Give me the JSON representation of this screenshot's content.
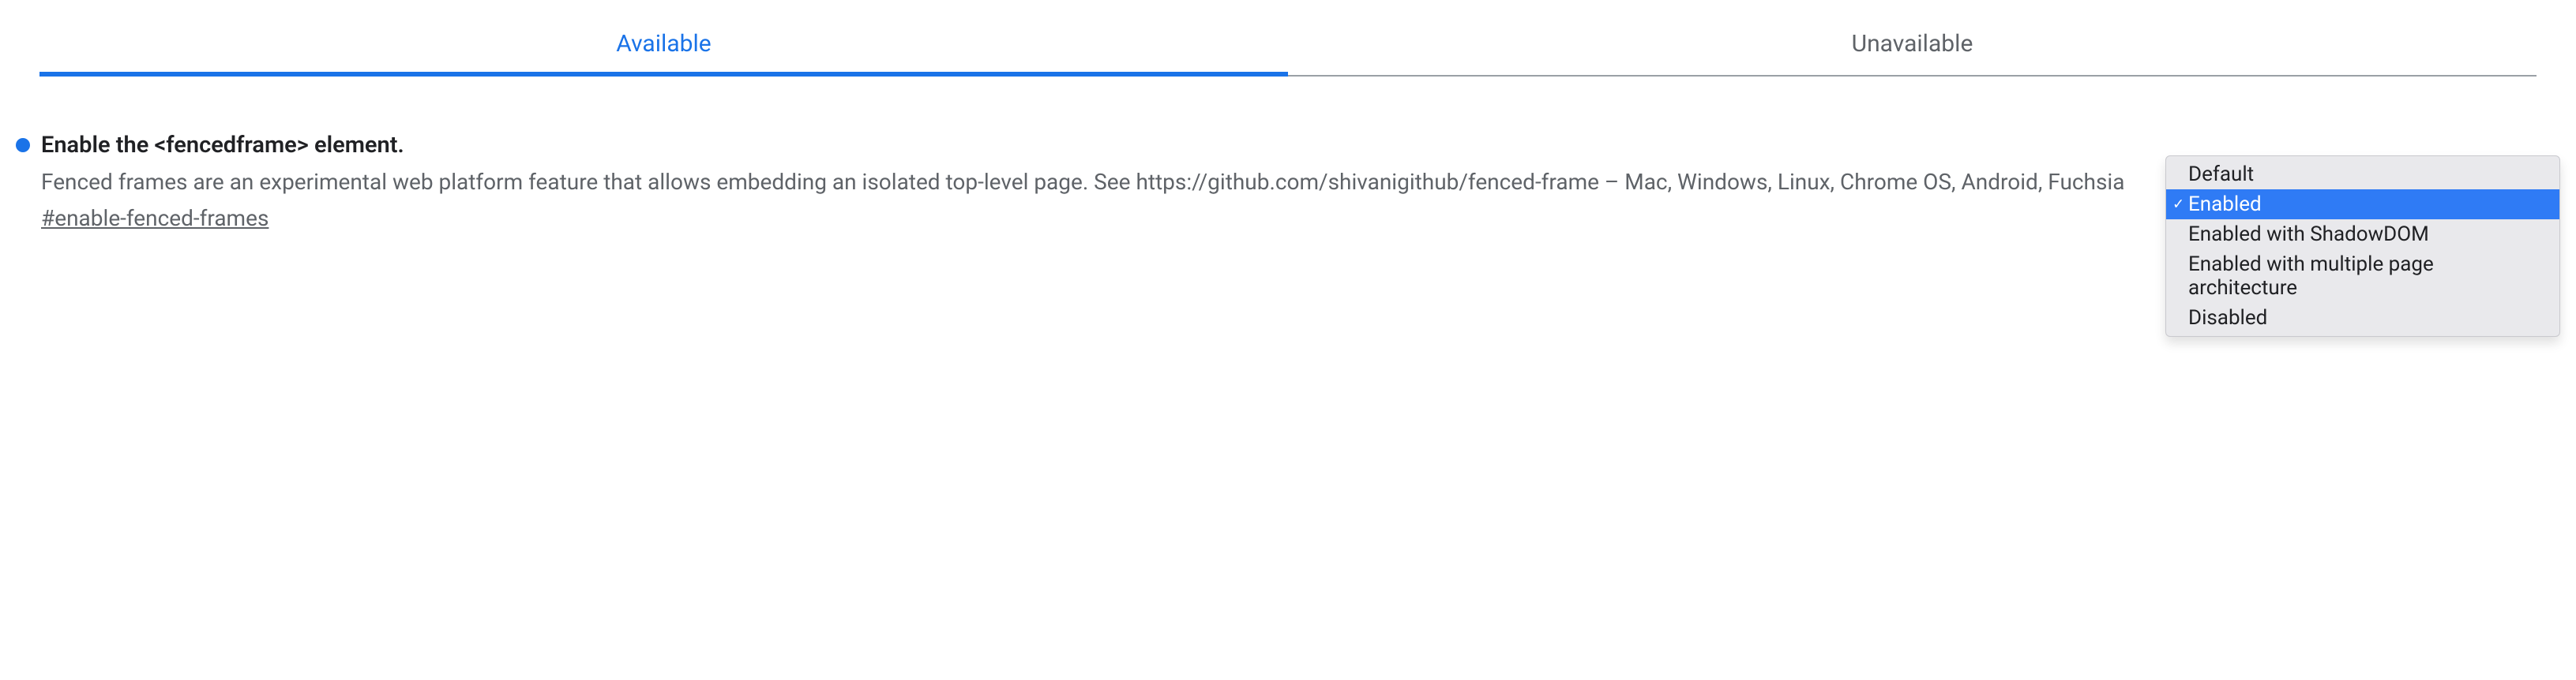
{
  "tabs": {
    "available": "Available",
    "unavailable": "Unavailable"
  },
  "flag": {
    "title": "Enable the <fencedframe> element.",
    "description": "Fenced frames are an experimental web platform feature that allows embedding an isolated top-level page. See https://github.com/shivanigithub/fenced-frame – Mac, Windows, Linux, Chrome OS, Android, Fuchsia",
    "anchor": "#enable-fenced-frames",
    "status_color": "#1a73e8"
  },
  "dropdown": {
    "options": [
      "Default",
      "Enabled",
      "Enabled with ShadowDOM",
      "Enabled with multiple page architecture",
      "Disabled"
    ],
    "selected_index": 1,
    "checkmark": "✓"
  }
}
